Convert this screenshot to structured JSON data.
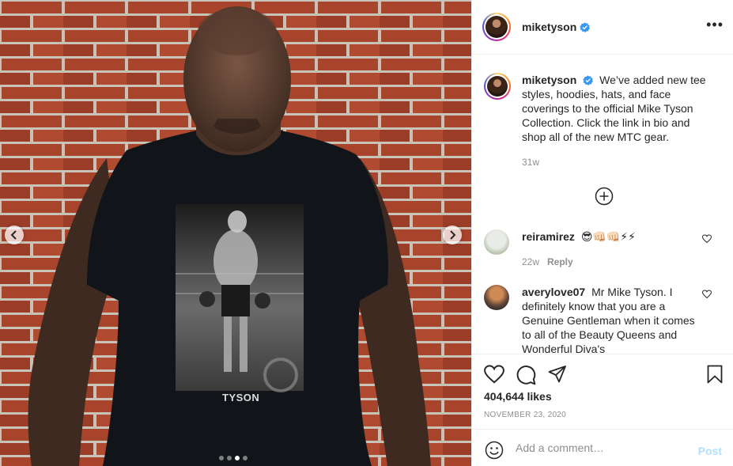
{
  "media": {
    "tee_text": "TYSON",
    "carousel": {
      "count": 4,
      "active_index": 2
    }
  },
  "header": {
    "username": "miketyson",
    "verified": true,
    "more_icon": "more-horizontal-icon"
  },
  "caption": {
    "username": "miketyson",
    "text": "We’ve added new tee styles, hoodies, hats, and face coverings to the official Mike Tyson Collection. Click the link in bio and shop all of the new MTC gear.",
    "time": "31w"
  },
  "comments": [
    {
      "username": "reiramirez",
      "text": "😎👊🏻👊🏻⚡⚡",
      "time": "22w",
      "reply_label": "Reply"
    },
    {
      "username": "averylove07",
      "text": "Mr Mike Tyson. I definitely know that you are a Genuine Gentleman when it comes to all of the Beauty Queens and Wonderful Diva's"
    }
  ],
  "actions": {
    "likes": "404,644 likes",
    "date": "NOVEMBER 23, 2020"
  },
  "composer": {
    "placeholder": "Add a comment…",
    "post_label": "Post"
  },
  "colors": {
    "verified_blue": "#3897f0",
    "post_disabled": "#b2dffc",
    "muted": "#8e8e8e",
    "text": "#262626"
  }
}
